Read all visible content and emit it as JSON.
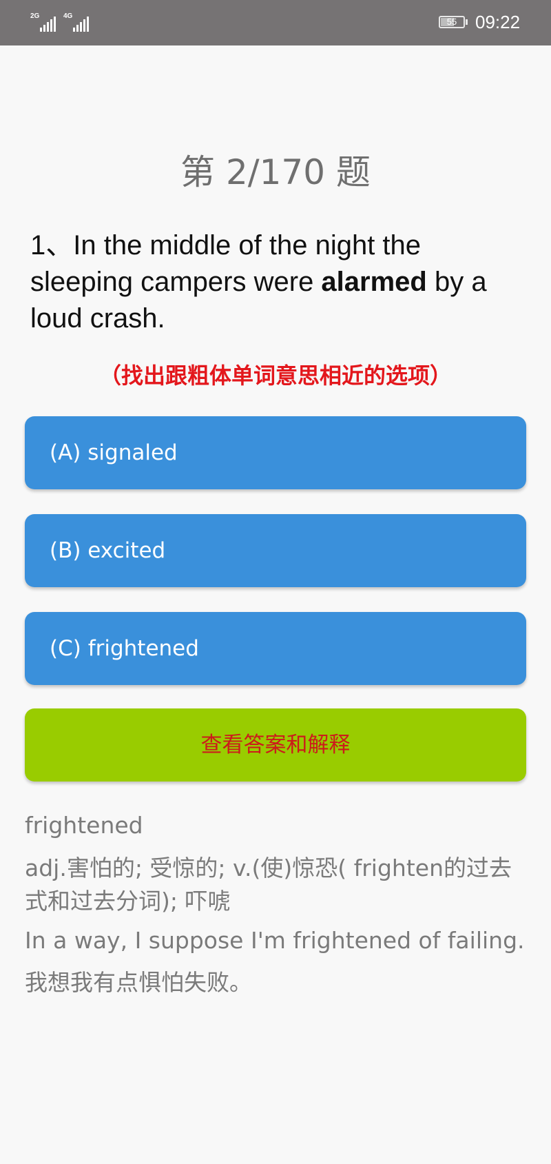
{
  "status_bar": {
    "signal1_label": "2G",
    "signal2_label": "4G",
    "battery_level": "55",
    "time": "09:22"
  },
  "quiz": {
    "counter": "第 2/170 题",
    "question_prefix": "1、In the middle of the night the sleeping campers were ",
    "question_bold": "alarmed",
    "question_suffix": " by a loud crash.",
    "instruction": "（找出跟粗体单词意思相近的选项）",
    "options": [
      {
        "label": "(A) signaled"
      },
      {
        "label": "(B) excited"
      },
      {
        "label": "(C) frightened"
      }
    ],
    "show_answer_label": "查看答案和解释"
  },
  "explanation": {
    "word": "frightened",
    "definition": "adj.害怕的; 受惊的; v.(使)惊恐( frighten的过去式和过去分词); 吓唬",
    "example_en": "In a way, I suppose I'm frightened of failing.",
    "example_zh": "我想我有点惧怕失败。"
  },
  "colors": {
    "status_bar": "#767374",
    "option_button": "#3a90db",
    "answer_button": "#99cc00",
    "instruction_text": "#e3171c"
  }
}
